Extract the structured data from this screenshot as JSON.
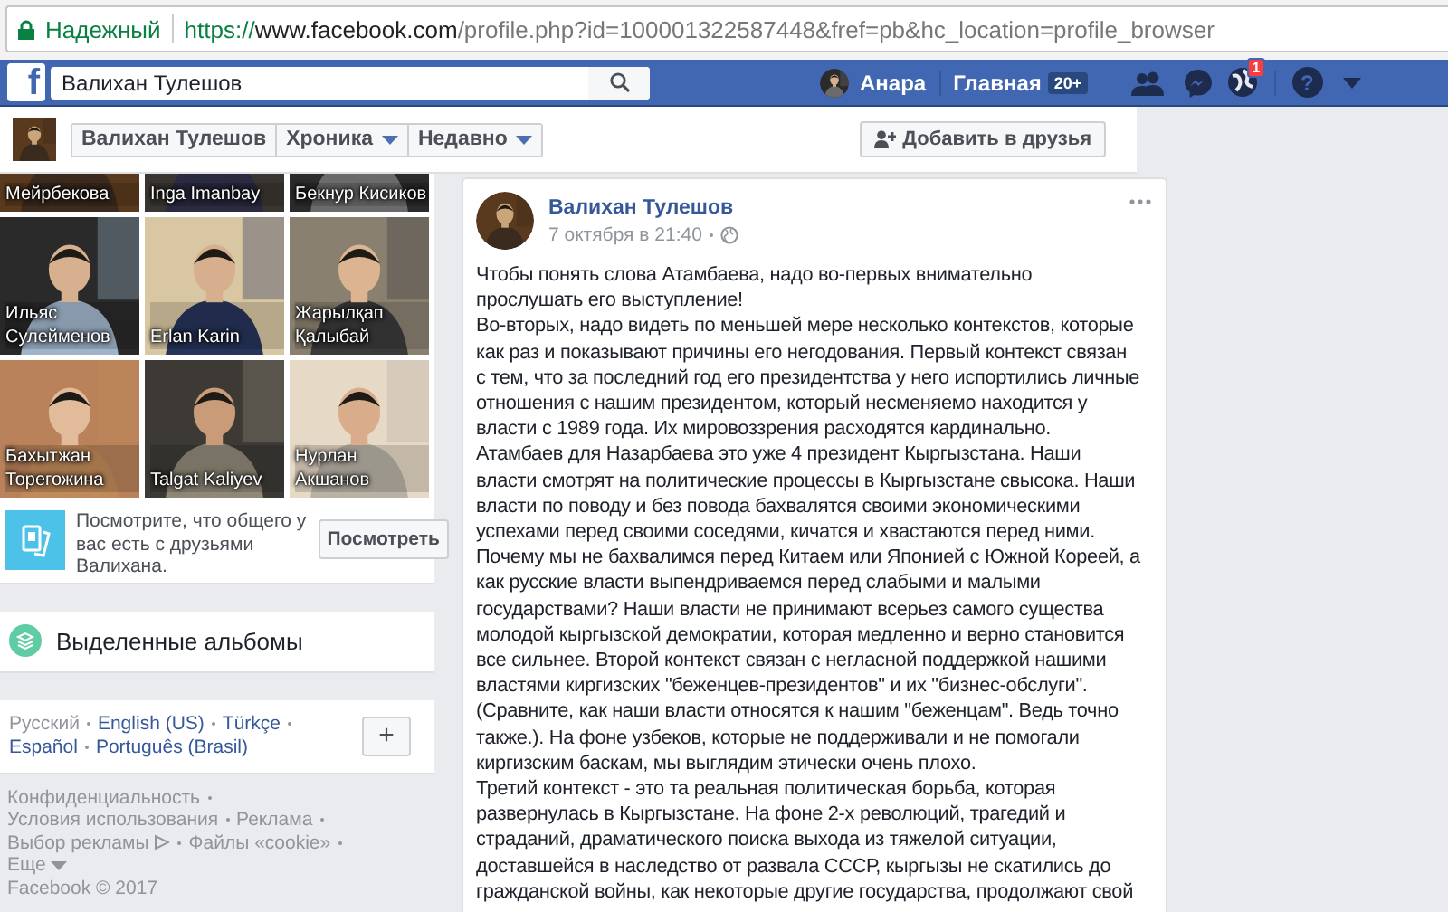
{
  "browser": {
    "security": "Надежный",
    "url_scheme": "https://",
    "url_host": "www.facebook.com",
    "url_path": "/profile.php?id=100001322587448&fref=pb&hc_location=profile_browser"
  },
  "topbar": {
    "logo": "f",
    "search": {
      "value": "Валихан Тулешов"
    },
    "user": "Анара",
    "home": "Главная",
    "home_badge": "20+",
    "notifications_badge": "1",
    "help": "?"
  },
  "profile_nav": {
    "items": [
      {
        "label": "Валихан Тулешов",
        "dropdown": false
      },
      {
        "label": "Хроника",
        "dropdown": true
      },
      {
        "label": "Недавно",
        "dropdown": true
      }
    ],
    "add_friend": "Добавить в друзья"
  },
  "friends": {
    "tiles": [
      {
        "name": "Мейрбекова"
      },
      {
        "name": "Inga Imanbay"
      },
      {
        "name": "Бекнур Кисиков"
      },
      {
        "name": "Ильяс Сулейменов"
      },
      {
        "name": "Erlan Karin"
      },
      {
        "name": "Жарылқап Қалыбай"
      },
      {
        "name": "Бахытжан Торегожина"
      },
      {
        "name": "Talgat Kaliyev"
      },
      {
        "name": "Нурлан Акшанов"
      }
    ],
    "suggestion": {
      "text": "Посмотрите, что общего у вас есть с друзьями Валихана.",
      "button": "Посмотреть"
    }
  },
  "albums": {
    "title": "Выделенные альбомы"
  },
  "languages": {
    "items": [
      {
        "label": "Русский",
        "selected": true
      },
      {
        "label": "English (US)",
        "selected": false
      },
      {
        "label": "Türkçe",
        "selected": false
      },
      {
        "label": "Español",
        "selected": false
      },
      {
        "label": "Português (Brasil)",
        "selected": false
      }
    ],
    "more": "+"
  },
  "footer": {
    "links": [
      {
        "label": "Конфиденциальность",
        "kind": "link"
      },
      {
        "label": "Условия использования",
        "kind": "link"
      },
      {
        "label": "Реклама",
        "kind": "link"
      },
      {
        "label": "Выбор рекламы",
        "kind": "adchoices"
      },
      {
        "label": "Файлы «cookie»",
        "kind": "link"
      },
      {
        "label": "Еще",
        "kind": "more"
      }
    ],
    "copyright": "Facebook © 2017"
  },
  "post": {
    "author": "Валихан Тулешов",
    "time": "7 октября в 21:40",
    "paragraphs": [
      "Чтобы понять слова Атамбаева, надо во-первых внимательно\nпрослушать его выступление!",
      "Во-вторых, надо видеть по меньшей мере несколько контекстов, которые\nкак раз и показывают причины его негодования. Первый контекст связан\nс тем, что за последний год его президентства у него испортились личные\nотношения с нашим президентом, который несменяемо находится у\nвласти с 1989 года. Их мировоззрения расходятся кардинально.",
      "Атамбаев для Назарбаева это уже 4 президент Кыргызстана. Наши\nвласти смотрят на политические процессы в Кыргызстане свысока. Наши\nвласти по поводу и без повода бахвалятся своими экономическими\nуспехами перед своими соседями, кичатся и хвастаются перед ними.\nПочему мы не бахвалимся перед Китаем или Японией с Южной Кореей, а\nкак русские власти выпендриваемся перед слабыми и малыми\nгосударствами? Наши власти не принимают всерьез самого существа\nмолодой кыргызской демократии, которая медленно и верно становится\nвсе сильнее. Второй контекст связан с негласной поддержкой нашими\nвластями киргизских \"беженцев-президентов\" и их \"бизнес-обслуги\".\n(Сравните, как наши власти относятся к нашим \"беженцам\". Ведь точно\nтакже.). На фоне узбеков, которые не поддерживали и не помогали\nкиргизским баскам, мы выглядим этически очень плохо.",
      "Третий контекст - это та реальная политическая борьба, которая\nразвернулась в Кыргызстане. На фоне 2-х революций, трагедий и\nстраданий, драматического поиска выхода из тяжелой ситуации,\nдоставшейся в наследство от развала СССР, кыргызы не скатились до\nгражданской войны, как некоторые другие государства, продолжают свой"
    ]
  }
}
